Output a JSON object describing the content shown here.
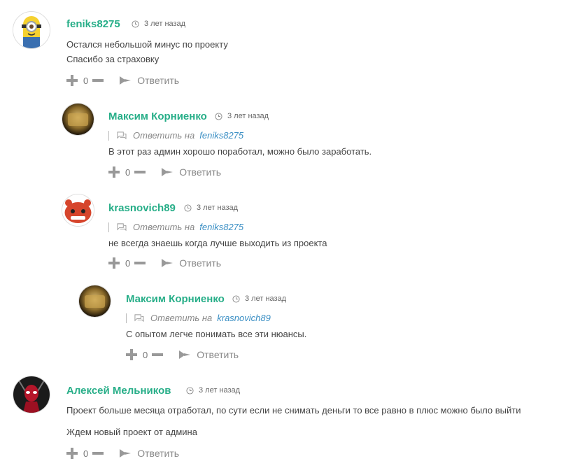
{
  "comments": [
    {
      "author": "feniks8275",
      "time": "3 лет назад",
      "reply_to_label": "",
      "reply_to_name": "",
      "lines": [
        "Остался небольшой минус по проекту",
        "Спасибо за страховку"
      ],
      "votes": "0",
      "reply_label": "Ответить"
    },
    {
      "author": "Максим Корниенко",
      "time": "3 лет назад",
      "reply_to_label": "Ответить на",
      "reply_to_name": "feniks8275",
      "lines": [
        "В этот раз админ хорошо поработал, можно было заработать."
      ],
      "votes": "0",
      "reply_label": "Ответить"
    },
    {
      "author": "krasnovich89",
      "time": "3 лет назад",
      "reply_to_label": "Ответить на",
      "reply_to_name": "feniks8275",
      "lines": [
        "не всегда знаешь когда лучше выходить из проекта"
      ],
      "votes": "0",
      "reply_label": "Ответить"
    },
    {
      "author": "Максим Корниенко",
      "time": "3 лет назад",
      "reply_to_label": "Ответить на",
      "reply_to_name": "krasnovich89",
      "lines": [
        "С опытом легче понимать все эти нюансы."
      ],
      "votes": "0",
      "reply_label": "Ответить"
    },
    {
      "author": "Алексей Мельников",
      "time": "3 лет назад",
      "reply_to_label": "",
      "reply_to_name": "",
      "lines": [
        "Проект больше месяца отработал, по сути если не снимать деньги то все равно в плюс можно было выйти",
        "Ждем новый проект от админа"
      ],
      "votes": "0",
      "reply_label": "Ответить"
    }
  ],
  "colors": {
    "author": "#27ae88",
    "link": "#3b8fc4",
    "icon": "#999999"
  },
  "icons": [
    "clock-icon",
    "reply-bubble-icon",
    "plus-icon",
    "minus-icon",
    "reply-arrow-icon"
  ]
}
